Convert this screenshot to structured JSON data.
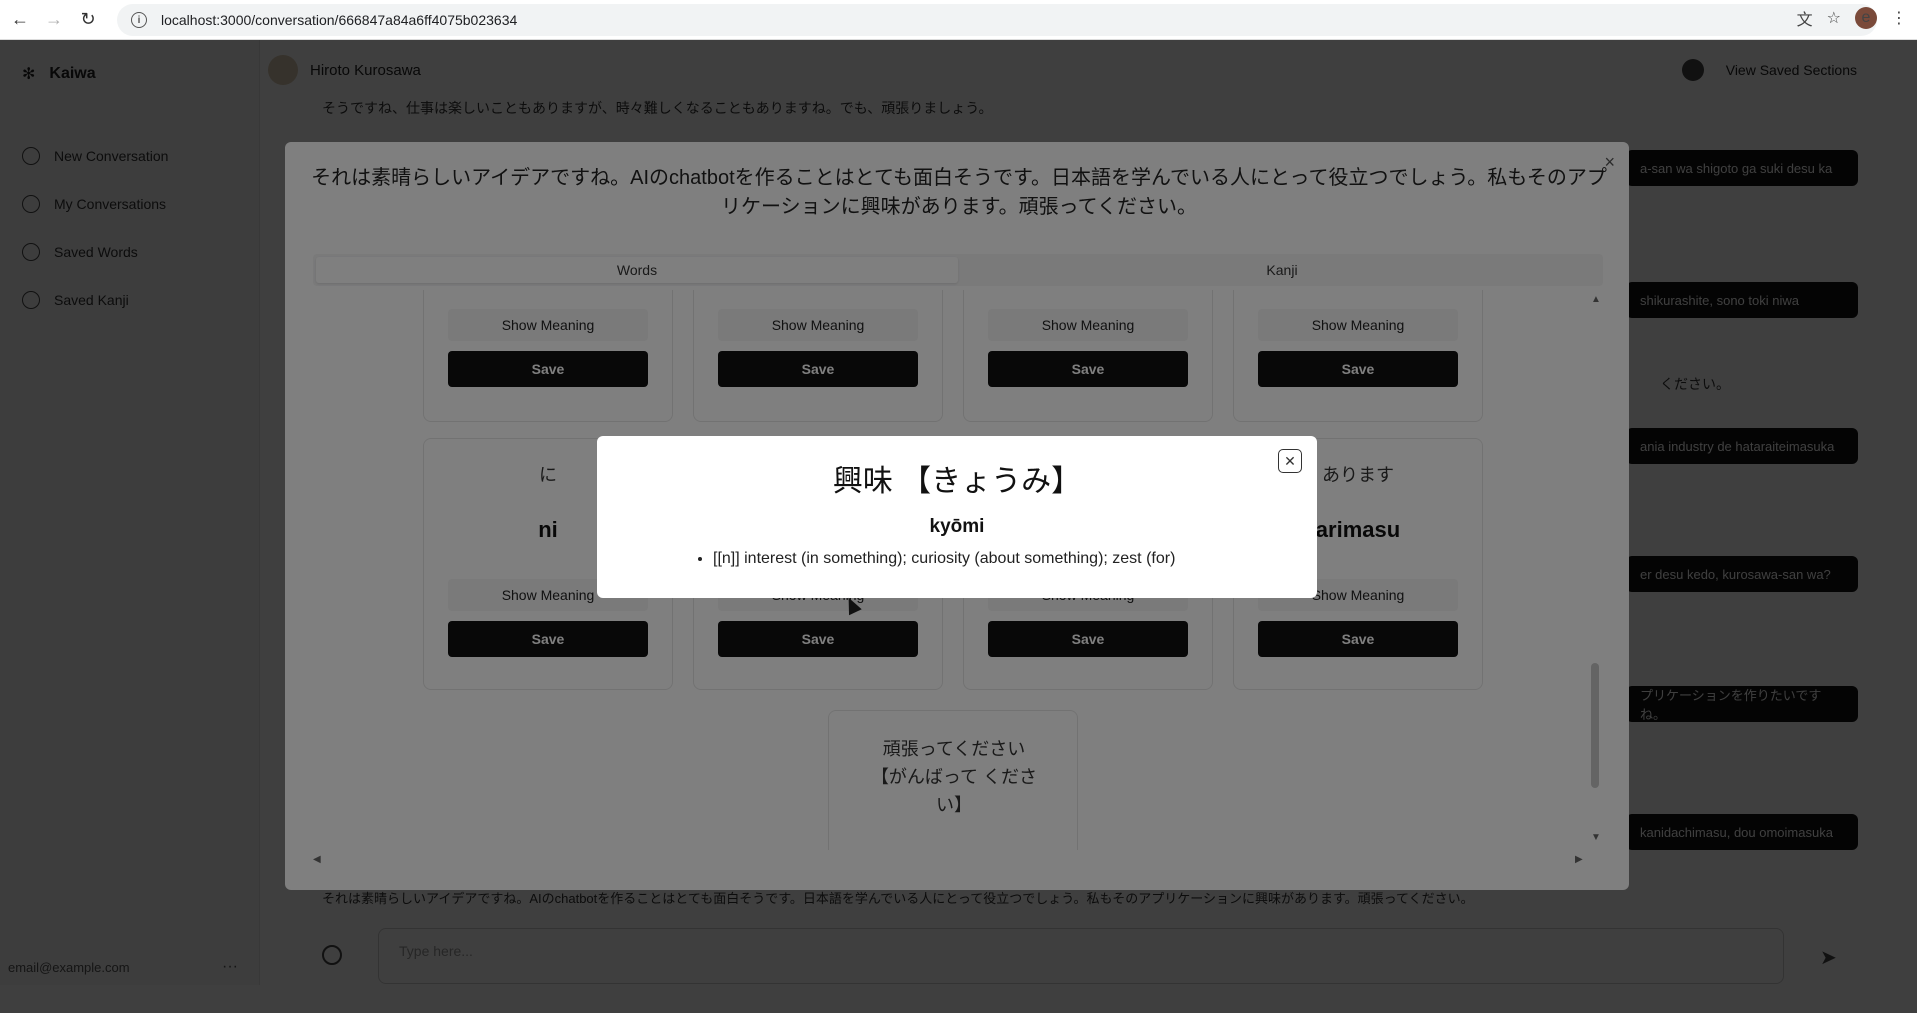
{
  "browser": {
    "url": "localhost:3000/conversation/666847a84a6ff4075b023634"
  },
  "app": {
    "brand": "Kaiwa",
    "sidebar": {
      "items": [
        {
          "label": "New Conversation",
          "icon": "plus-circle-icon"
        },
        {
          "label": "My Conversations",
          "icon": "chat-icon"
        },
        {
          "label": "Saved Words",
          "icon": "chat-icon"
        },
        {
          "label": "Saved Kanji",
          "icon": "chat-icon"
        }
      ],
      "footer_email": "email@example.com"
    },
    "header": {
      "name": "Hiroto Kurosawa",
      "right_label": "View Saved Sections"
    },
    "chat": {
      "top_line": "そうですね、仕事は楽しいこともありますが、時々難しくなることもありますね。でも、頑張りましょう。",
      "bubbles": [
        "a-san wa shigoto ga suki desu ka",
        "shikurashite, sono toki niwa",
        "ください。",
        "ania industry de hataraiteimasuka",
        "er desu kedo, kurosawa-san wa?",
        "プリケーションを作りたいですね。",
        "kanidachimasu, dou omoimasuka"
      ],
      "bottom_line": "それは素晴らしいアイデアですね。AIのchatbotを作ることはとても面白そうです。日本語を学んでいる人にとって役立つでしょう。私もそのアプリケーションに興味があります。頑張ってください。",
      "input_placeholder": "Type here..."
    }
  },
  "breakdown_dialog": {
    "sentence": "それは素晴らしいアイデアですね。AIのchatbotを作ることはとても面白そうです。日本語を学んでいる人にとって役立つでしょう。私もそのアプリケーションに興味があります。頑張ってください。",
    "tabs": [
      "Words",
      "Kanji"
    ],
    "active_tab": "Words",
    "show_meaning_label": "Show Meaning",
    "save_label": "Save",
    "cards": [
      {
        "jp": "",
        "romaji": ""
      },
      {
        "jp": "",
        "romaji": ""
      },
      {
        "jp": "",
        "romaji": ""
      },
      {
        "jp": "",
        "romaji": ""
      },
      {
        "jp": "に",
        "romaji": "ni"
      },
      {
        "jp": "",
        "romaji": ""
      },
      {
        "jp": "",
        "romaji": ""
      },
      {
        "jp": "あります",
        "romaji": "arimasu"
      },
      {
        "jp": "頑張ってください【がんばって ください】",
        "romaji": ""
      }
    ]
  },
  "definition_dialog": {
    "title": "興味 【きょうみ】",
    "reading": "kyōmi",
    "definitions": [
      "[[n]] interest (in something); curiosity (about something); zest (for)"
    ]
  }
}
